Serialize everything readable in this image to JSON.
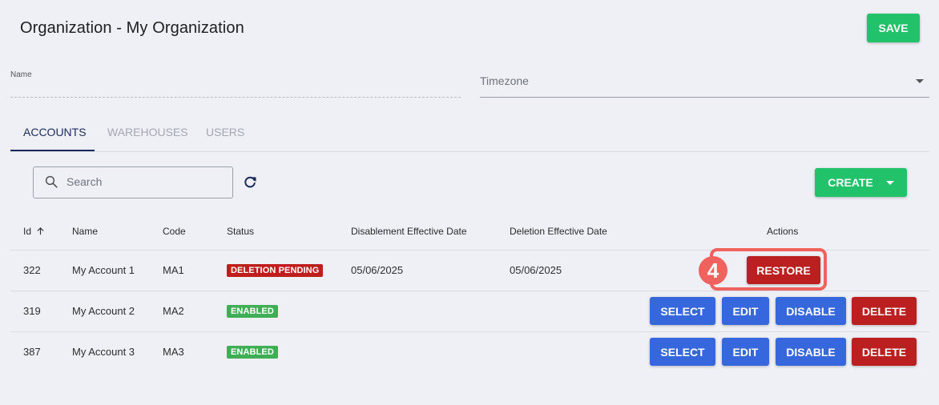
{
  "header": {
    "title": "Organization - My Organization",
    "save_label": "SAVE"
  },
  "form": {
    "name_label": "Name",
    "name_value": "",
    "timezone_placeholder": "Timezone"
  },
  "tabs": [
    {
      "label": "ACCOUNTS",
      "active": true
    },
    {
      "label": "WAREHOUSES",
      "active": false
    },
    {
      "label": "USERS",
      "active": false
    }
  ],
  "toolbar": {
    "search_placeholder": "Search",
    "create_label": "CREATE"
  },
  "table": {
    "headers": {
      "id": "Id",
      "name": "Name",
      "code": "Code",
      "status": "Status",
      "disablement": "Disablement Effective Date",
      "deletion": "Deletion Effective Date",
      "actions": "Actions"
    },
    "sort_column": "id",
    "sort_direction": "ascending",
    "rows": [
      {
        "id": "322",
        "name": "My Account 1",
        "code": "MA1",
        "status": "DELETION PENDING",
        "disablement_date": "05/06/2025",
        "deletion_date": "05/06/2025",
        "actions": [
          "RESTORE"
        ]
      },
      {
        "id": "319",
        "name": "My Account 2",
        "code": "MA2",
        "status": "ENABLED",
        "disablement_date": "",
        "deletion_date": "",
        "actions": [
          "SELECT",
          "EDIT",
          "DISABLE",
          "DELETE"
        ]
      },
      {
        "id": "387",
        "name": "My Account 3",
        "code": "MA3",
        "status": "ENABLED",
        "disablement_date": "",
        "deletion_date": "",
        "actions": [
          "SELECT",
          "EDIT",
          "DISABLE",
          "DELETE"
        ]
      }
    ]
  },
  "annotation": {
    "step_number": "4"
  },
  "colors": {
    "primary_green": "#22c26b",
    "action_blue": "#3667dd",
    "danger_red": "#bb1f1f",
    "enabled_badge": "#3fae55",
    "pending_badge": "#c01d1d",
    "callout": "#f0625d",
    "active_tab": "#1b2a5c"
  }
}
